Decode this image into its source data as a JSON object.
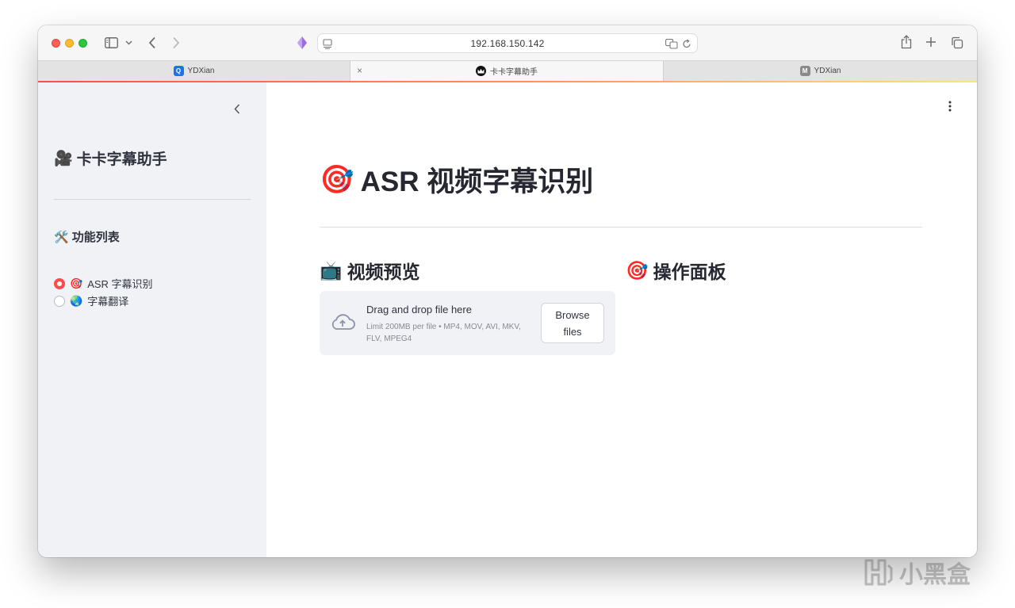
{
  "browser": {
    "address": "192.168.150.142",
    "tabs": [
      {
        "label": "YDXian",
        "favicon": "q-app-icon"
      },
      {
        "label": "卡卡字幕助手",
        "favicon": "crown-icon",
        "active": true
      },
      {
        "label": "YDXian",
        "favicon": "m-app-icon"
      }
    ],
    "tab_close": "×",
    "favicon_q": "Q",
    "favicon_m": "M"
  },
  "sidebar": {
    "title_icon": "🎥",
    "title": "卡卡字幕助手",
    "section_icon": "🛠️",
    "section_title": "功能列表",
    "options": [
      {
        "icon": "🎯",
        "label": "ASR 字幕识别",
        "selected": true
      },
      {
        "icon": "🌏",
        "label": "字幕翻译",
        "selected": false
      }
    ]
  },
  "main": {
    "title_icon": "🎯",
    "title": "ASR 视频字幕识别",
    "left_header_icon": "📺",
    "left_header": "视频预览",
    "right_header_icon": "🎯",
    "right_header": "操作面板",
    "uploader": {
      "title": "Drag and drop file here",
      "limit": "Limit 200MB per file • MP4, MOV, AVI, MKV, FLV, MPEG4",
      "button": "Browse files"
    }
  },
  "watermark": "小黑盒",
  "colors": {
    "accent": "#ff4b4b",
    "sidebar_bg": "#f0f2f6",
    "text": "#31333f"
  }
}
